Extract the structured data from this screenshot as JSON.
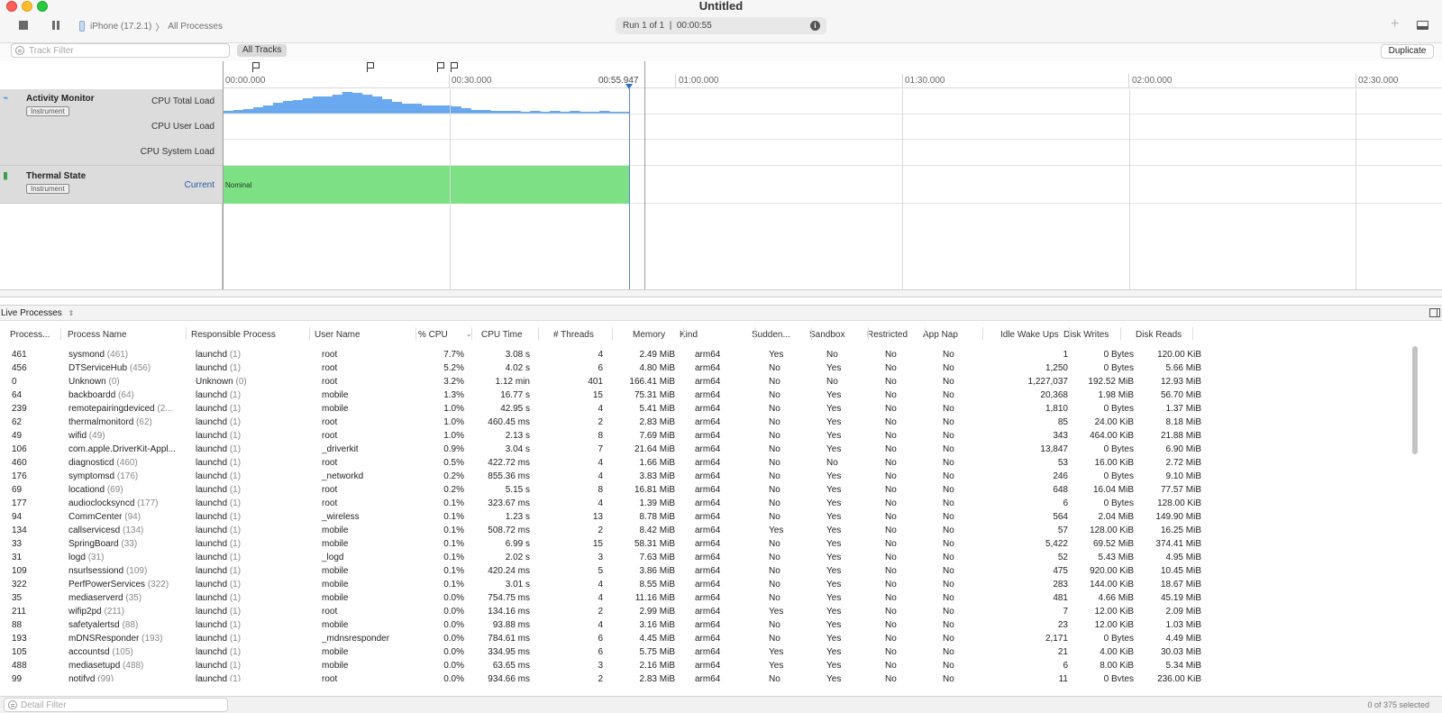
{
  "window": {
    "title": "Untitled"
  },
  "toolbar": {
    "device": "iPhone (17.2.1)",
    "target": "All Processes",
    "run_info": "Run 1 of 1  |  00:00:55",
    "info_icon": "info-icon",
    "add_icon": "plus-icon",
    "panel_icon": "bottom-panel-icon"
  },
  "filters": {
    "track_filter_placeholder": "Track Filter",
    "all_tracks": "All Tracks",
    "duplicate": "Duplicate",
    "detail_filter_placeholder": "Detail Filter"
  },
  "timeline": {
    "ticks": [
      "00:00.000",
      "00:30.000",
      "01:00.000",
      "01:30.000",
      "02:00.000",
      "02:30.000"
    ],
    "playhead": "00:55.947",
    "tracks": [
      {
        "name": "Activity Monitor",
        "badge": "Instrument",
        "icon": "activity-monitor-icon",
        "subtracks": [
          "CPU Total Load",
          "CPU User Load",
          "CPU System Load"
        ]
      },
      {
        "name": "Thermal State",
        "badge": "Instrument",
        "icon": "thermometer-icon",
        "subtracks": [
          "Current"
        ],
        "value": "Nominal"
      }
    ],
    "cpu_total_load": [
      2,
      3,
      5,
      7,
      9,
      13,
      15,
      17,
      19,
      22,
      21,
      24,
      27,
      26,
      24,
      22,
      18,
      14,
      12,
      12,
      10,
      10,
      9,
      8,
      6,
      4,
      3,
      2,
      2,
      2,
      1,
      2,
      1,
      2,
      1,
      2,
      1,
      1,
      2,
      1,
      1
    ],
    "accent_color": "#6aa8f0",
    "thermal_color": "#7de085"
  },
  "detail": {
    "view": "Live Processes",
    "columns": [
      "Process...",
      "Process Name",
      "Responsible Process",
      "User Name",
      "% CPU",
      "CPU Time",
      "# Threads",
      "Memory",
      "Kind",
      "Sudden...",
      "Sandbox",
      "Restricted",
      "App Nap",
      "Idle Wake Ups",
      "Disk Writes",
      "Disk Reads"
    ],
    "rows": [
      [
        "461",
        "sysmond",
        "(461)",
        "launchd",
        "(1)",
        "root",
        "7.7%",
        "3.08 s",
        "4",
        "2.49 MiB",
        "arm64",
        "Yes",
        "No",
        "No",
        "No",
        "1",
        "0 Bytes",
        "120.00 KiB"
      ],
      [
        "456",
        "DTServiceHub",
        "(456)",
        "launchd",
        "(1)",
        "root",
        "5.2%",
        "4.02 s",
        "6",
        "4.80 MiB",
        "arm64",
        "No",
        "Yes",
        "No",
        "No",
        "1,250",
        "0 Bytes",
        "5.66 MiB"
      ],
      [
        "0",
        "Unknown",
        "(0)",
        "Unknown",
        "(0)",
        "root",
        "3.2%",
        "1.12 min",
        "401",
        "166.41 MiB",
        "arm64",
        "No",
        "No",
        "No",
        "No",
        "1,227,037",
        "192.52 MiB",
        "12.93 MiB"
      ],
      [
        "64",
        "backboardd",
        "(64)",
        "launchd",
        "(1)",
        "mobile",
        "1.3%",
        "16.77 s",
        "15",
        "75.31 MiB",
        "arm64",
        "No",
        "Yes",
        "No",
        "No",
        "20,368",
        "1.98 MiB",
        "56.70 MiB"
      ],
      [
        "239",
        "remotepairingdeviced",
        "(2...",
        "launchd",
        "(1)",
        "mobile",
        "1.0%",
        "42.95 s",
        "4",
        "5.41 MiB",
        "arm64",
        "No",
        "Yes",
        "No",
        "No",
        "1,810",
        "0 Bytes",
        "1.37 MiB"
      ],
      [
        "62",
        "thermalmonitord",
        "(62)",
        "launchd",
        "(1)",
        "root",
        "1.0%",
        "460.45 ms",
        "2",
        "2.83 MiB",
        "arm64",
        "No",
        "Yes",
        "No",
        "No",
        "85",
        "24.00 KiB",
        "8.18 MiB"
      ],
      [
        "49",
        "wifid",
        "(49)",
        "launchd",
        "(1)",
        "root",
        "1.0%",
        "2.13 s",
        "8",
        "7.69 MiB",
        "arm64",
        "No",
        "Yes",
        "No",
        "No",
        "343",
        "464.00 KiB",
        "21.88 MiB"
      ],
      [
        "106",
        "com.apple.DriverKit-Appl...",
        "",
        "launchd",
        "(1)",
        "_driverkit",
        "0.9%",
        "3.04 s",
        "7",
        "21.64 MiB",
        "arm64",
        "No",
        "Yes",
        "No",
        "No",
        "13,847",
        "0 Bytes",
        "6.90 MiB"
      ],
      [
        "460",
        "diagnosticd",
        "(460)",
        "launchd",
        "(1)",
        "root",
        "0.5%",
        "422.72 ms",
        "4",
        "1.66 MiB",
        "arm64",
        "No",
        "No",
        "No",
        "No",
        "53",
        "16.00 KiB",
        "2.72 MiB"
      ],
      [
        "176",
        "symptomsd",
        "(176)",
        "launchd",
        "(1)",
        "_networkd",
        "0.2%",
        "855.36 ms",
        "4",
        "3.83 MiB",
        "arm64",
        "No",
        "Yes",
        "No",
        "No",
        "246",
        "0 Bytes",
        "9.10 MiB"
      ],
      [
        "69",
        "locationd",
        "(69)",
        "launchd",
        "(1)",
        "root",
        "0.2%",
        "5.15 s",
        "8",
        "16.81 MiB",
        "arm64",
        "No",
        "Yes",
        "No",
        "No",
        "648",
        "16.04 MiB",
        "77.57 MiB"
      ],
      [
        "177",
        "audioclocksyncd",
        "(177)",
        "launchd",
        "(1)",
        "root",
        "0.1%",
        "323.67 ms",
        "4",
        "1.39 MiB",
        "arm64",
        "No",
        "Yes",
        "No",
        "No",
        "6",
        "0 Bytes",
        "128.00 KiB"
      ],
      [
        "94",
        "CommCenter",
        "(94)",
        "launchd",
        "(1)",
        "_wireless",
        "0.1%",
        "1.23 s",
        "13",
        "8.78 MiB",
        "arm64",
        "No",
        "Yes",
        "No",
        "No",
        "564",
        "2.04 MiB",
        "149.90 MiB"
      ],
      [
        "134",
        "callservicesd",
        "(134)",
        "launchd",
        "(1)",
        "mobile",
        "0.1%",
        "508.72 ms",
        "2",
        "8.42 MiB",
        "arm64",
        "Yes",
        "Yes",
        "No",
        "No",
        "57",
        "128.00 KiB",
        "16.25 MiB"
      ],
      [
        "33",
        "SpringBoard",
        "(33)",
        "launchd",
        "(1)",
        "mobile",
        "0.1%",
        "6.99 s",
        "15",
        "58.31 MiB",
        "arm64",
        "No",
        "Yes",
        "No",
        "No",
        "5,422",
        "69.52 MiB",
        "374.41 MiB"
      ],
      [
        "31",
        "logd",
        "(31)",
        "launchd",
        "(1)",
        "_logd",
        "0.1%",
        "2.02 s",
        "3",
        "7.63 MiB",
        "arm64",
        "No",
        "Yes",
        "No",
        "No",
        "52",
        "5.43 MiB",
        "4.95 MiB"
      ],
      [
        "109",
        "nsurlsessiond",
        "(109)",
        "launchd",
        "(1)",
        "mobile",
        "0.1%",
        "420.24 ms",
        "5",
        "3.86 MiB",
        "arm64",
        "No",
        "Yes",
        "No",
        "No",
        "475",
        "920.00 KiB",
        "10.45 MiB"
      ],
      [
        "322",
        "PerfPowerServices",
        "(322)",
        "launchd",
        "(1)",
        "mobile",
        "0.1%",
        "3.01 s",
        "4",
        "8.55 MiB",
        "arm64",
        "No",
        "Yes",
        "No",
        "No",
        "283",
        "144.00 KiB",
        "18.67 MiB"
      ],
      [
        "35",
        "mediaserverd",
        "(35)",
        "launchd",
        "(1)",
        "mobile",
        "0.0%",
        "754.75 ms",
        "4",
        "11.16 MiB",
        "arm64",
        "No",
        "Yes",
        "No",
        "No",
        "481",
        "4.66 MiB",
        "45.19 MiB"
      ],
      [
        "211",
        "wifip2pd",
        "(211)",
        "launchd",
        "(1)",
        "root",
        "0.0%",
        "134.16 ms",
        "2",
        "2.99 MiB",
        "arm64",
        "Yes",
        "Yes",
        "No",
        "No",
        "7",
        "12.00 KiB",
        "2.09 MiB"
      ],
      [
        "88",
        "safetyalertsd",
        "(88)",
        "launchd",
        "(1)",
        "mobile",
        "0.0%",
        "93.88 ms",
        "4",
        "3.16 MiB",
        "arm64",
        "No",
        "Yes",
        "No",
        "No",
        "23",
        "12.00 KiB",
        "1.03 MiB"
      ],
      [
        "193",
        "mDNSResponder",
        "(193)",
        "launchd",
        "(1)",
        "_mdnsresponder",
        "0.0%",
        "784.61 ms",
        "6",
        "4.45 MiB",
        "arm64",
        "No",
        "Yes",
        "No",
        "No",
        "2,171",
        "0 Bytes",
        "4.49 MiB"
      ],
      [
        "105",
        "accountsd",
        "(105)",
        "launchd",
        "(1)",
        "mobile",
        "0.0%",
        "334.95 ms",
        "6",
        "5.75 MiB",
        "arm64",
        "Yes",
        "Yes",
        "No",
        "No",
        "21",
        "4.00 KiB",
        "30.03 MiB"
      ],
      [
        "488",
        "mediasetupd",
        "(488)",
        "launchd",
        "(1)",
        "mobile",
        "0.0%",
        "63.65 ms",
        "3",
        "2.16 MiB",
        "arm64",
        "Yes",
        "Yes",
        "No",
        "No",
        "6",
        "8.00 KiB",
        "5.34 MiB"
      ],
      [
        "99",
        "notifyd",
        "(99)",
        "launchd",
        "(1)",
        "root",
        "0.0%",
        "934.66 ms",
        "2",
        "2.83 MiB",
        "arm64",
        "No",
        "Yes",
        "No",
        "No",
        "11",
        "0 Bytes",
        "236.00 KiB"
      ]
    ],
    "selected_count": "0 of 375 selected"
  }
}
